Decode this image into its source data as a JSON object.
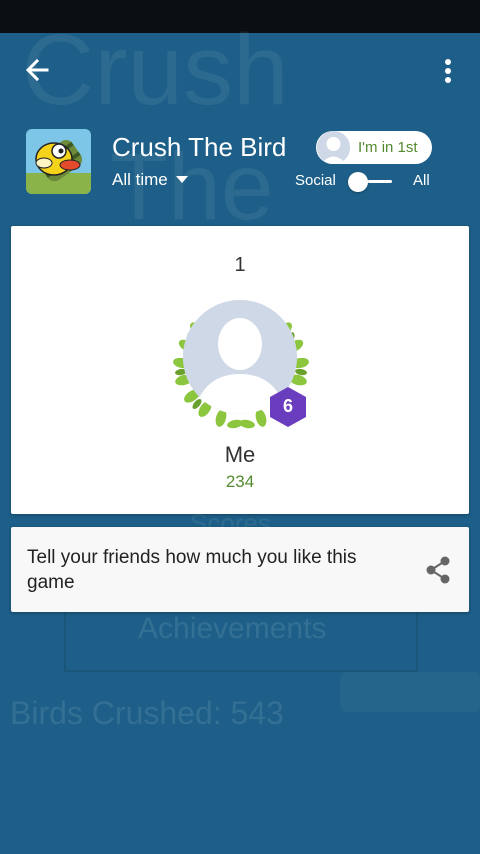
{
  "background": {
    "title_line1": "Crush",
    "title_line2": "The",
    "scores_label": "Scores",
    "achievements_label": "Achievements",
    "birds_crushed": "Birds Crushed: 543"
  },
  "header": {
    "back_icon": "arrow-left-icon",
    "menu_icon": "more-vert-icon",
    "game_title": "Crush The Bird",
    "time_filter": "All time",
    "rank_text": "I'm in 1st",
    "toggle_left": "Social",
    "toggle_right": "All"
  },
  "player_card": {
    "rank": "1",
    "level": "6",
    "name": "Me",
    "score": "234"
  },
  "share": {
    "text": "Tell your friends how much you like this game",
    "icon": "share-icon"
  },
  "colors": {
    "background": "#1d5f88",
    "accent_green": "#558b2f",
    "level_purple": "#6a3dbf"
  }
}
